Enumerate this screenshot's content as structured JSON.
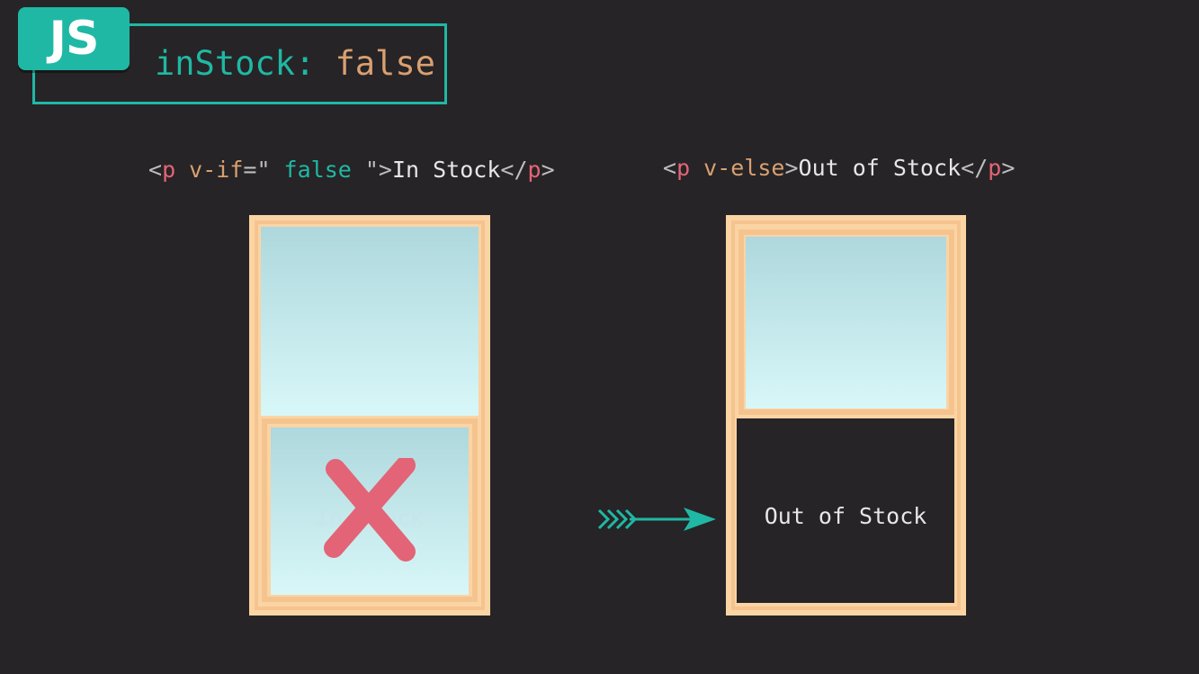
{
  "badge": {
    "label": "JS"
  },
  "state": {
    "key": "inStock",
    "colon": ":",
    "value": "false"
  },
  "code_if": {
    "open_lt": "<",
    "tag": "p",
    "attr": " v-if",
    "eq_quote": "=\"",
    "expr": " false ",
    "close_quote": "\">",
    "text": "In Stock",
    "close_lt": "</",
    "close_tag": "p",
    "close_gt": ">"
  },
  "code_else": {
    "open_lt": "<",
    "tag": "p",
    "attr": " v-else",
    "gt": ">",
    "text": "Out of Stock",
    "close_lt": "</",
    "close_tag": "p",
    "close_gt": ">"
  },
  "left_window": {
    "hidden_text": "In Stock"
  },
  "right_window": {
    "pane_text": "Out of Stock"
  },
  "colors": {
    "accent": "#1fb8a4",
    "frame": "#fbd4a4",
    "cross": "#e36476",
    "background": "#262426"
  },
  "icons": {
    "cross": "cross-mark-icon",
    "arrow": "arrow-right-icon"
  }
}
